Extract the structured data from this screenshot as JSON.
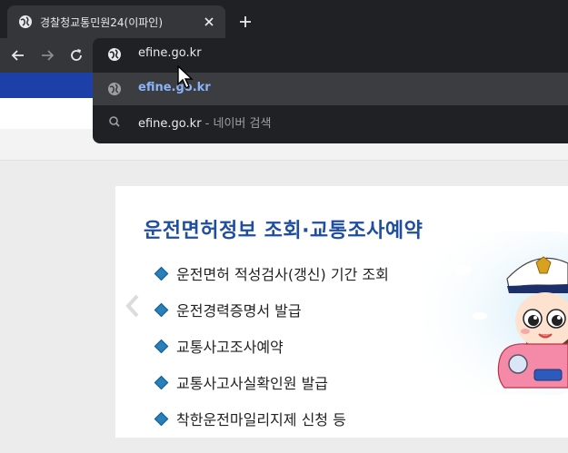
{
  "tab": {
    "title": "경찰청교통민원24(이파인)"
  },
  "omnibox": {
    "input_value": "efine.go.kr",
    "suggestions": [
      {
        "text": "efine.go.kr",
        "icon": "globe-icon",
        "selected": true
      },
      {
        "text": "efine.go.kr",
        "suffix": " - 네이버 검색",
        "icon": "search-icon"
      }
    ]
  },
  "card": {
    "title": "운전면허정보 조회·교통조사예약",
    "items": [
      "운전면허 적성검사(갱신) 기간 조회",
      "운전경력증명서 발급",
      "교통사고조사예약",
      "교통사고사실확인원 발급",
      "착한운전마일리지제 신청 등"
    ]
  },
  "colors": {
    "title_blue": "#1f4e9e",
    "band_blue": "#1d3fa8",
    "link_blue": "#8ab4f8"
  }
}
